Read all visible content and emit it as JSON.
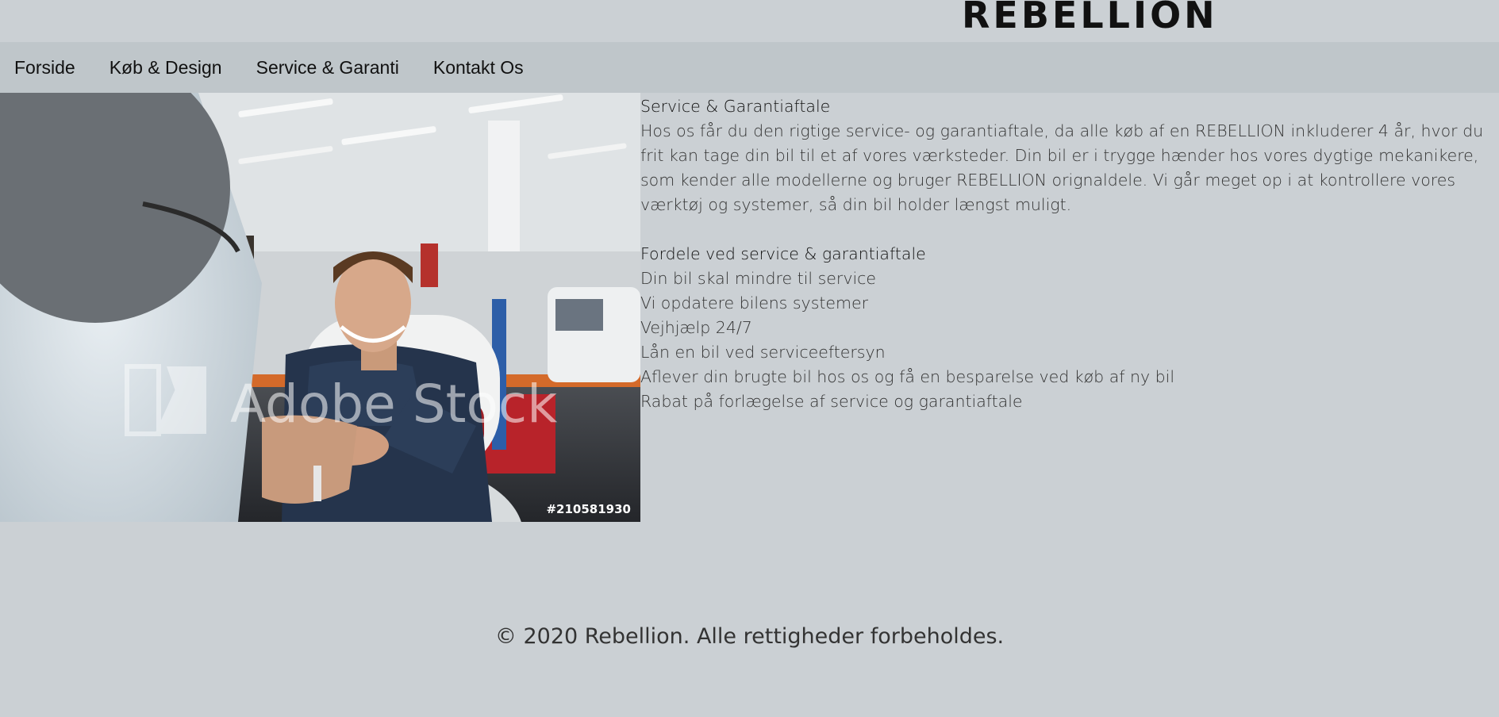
{
  "brand": {
    "logo_text": "REBELLION"
  },
  "nav": {
    "items": [
      {
        "label": "Forside"
      },
      {
        "label": "Køb & Design"
      },
      {
        "label": "Service & Garanti"
      },
      {
        "label": "Kontakt Os"
      }
    ]
  },
  "hero_image": {
    "watermark": "Adobe Stock",
    "stock_id": "#210581930"
  },
  "content": {
    "title": "Service & Garantiaftale",
    "intro": "Hos os får du den rigtige service- og garantiaftale, da alle køb af en REBELLION inkluderer 4 år, hvor du frit kan tage din bil til et af vores værksteder. Din bil er i trygge hænder hos vores dygtige mekanikere, som kender alle modellerne og bruger REBELLION orignaldele. Vi går meget op i at kontrollere vores værktøj og systemer, så din bil holder længst muligt.",
    "benefits_title": "Fordele ved service & garantiaftale",
    "benefits": [
      "Din bil skal mindre til service",
      "Vi opdatere bilens systemer",
      "Vejhjælp 24/7",
      "Lån en bil ved serviceeftersyn",
      "Aflever din brugte bil hos os og få en besparelse ved køb af ny bil",
      "Rabat på forlægelse af service og garantiaftale"
    ]
  },
  "footer": {
    "copyright": "© 2020 Rebellion. Alle rettigheder forbeholdes."
  }
}
